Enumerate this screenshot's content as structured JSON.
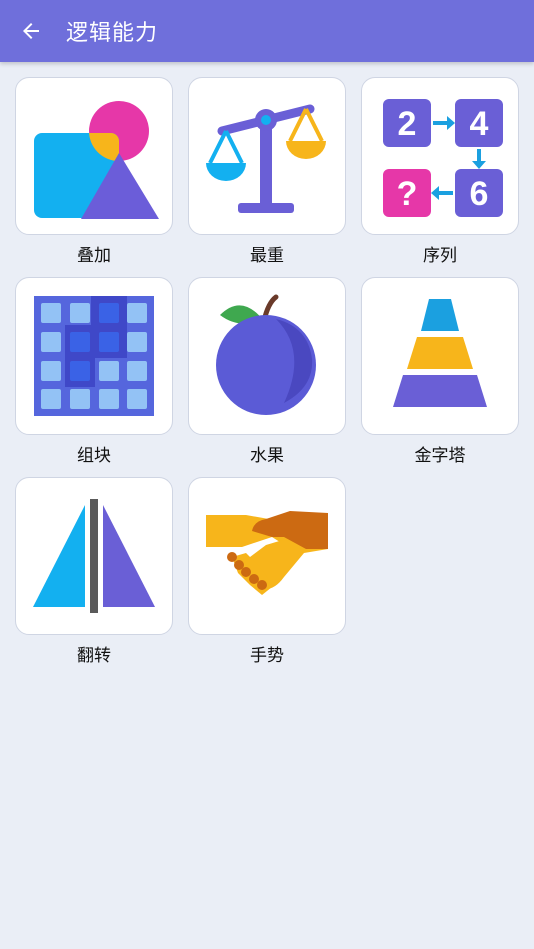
{
  "header": {
    "title": "逻辑能力",
    "back_icon": "arrow-left-icon",
    "color": "#6f6fdb"
  },
  "items": [
    {
      "label": "叠加",
      "icon": "overlap-shapes-icon"
    },
    {
      "label": "最重",
      "icon": "balance-scale-icon"
    },
    {
      "label": "序列",
      "icon": "number-sequence-icon"
    },
    {
      "label": "组块",
      "icon": "block-grid-icon"
    },
    {
      "label": "水果",
      "icon": "plum-fruit-icon"
    },
    {
      "label": "金字塔",
      "icon": "pyramid-icon"
    },
    {
      "label": "翻转",
      "icon": "mirror-flip-icon"
    },
    {
      "label": "手势",
      "icon": "handshake-icon"
    }
  ],
  "sequence_numbers": [
    "2",
    "4",
    "?",
    "6"
  ]
}
